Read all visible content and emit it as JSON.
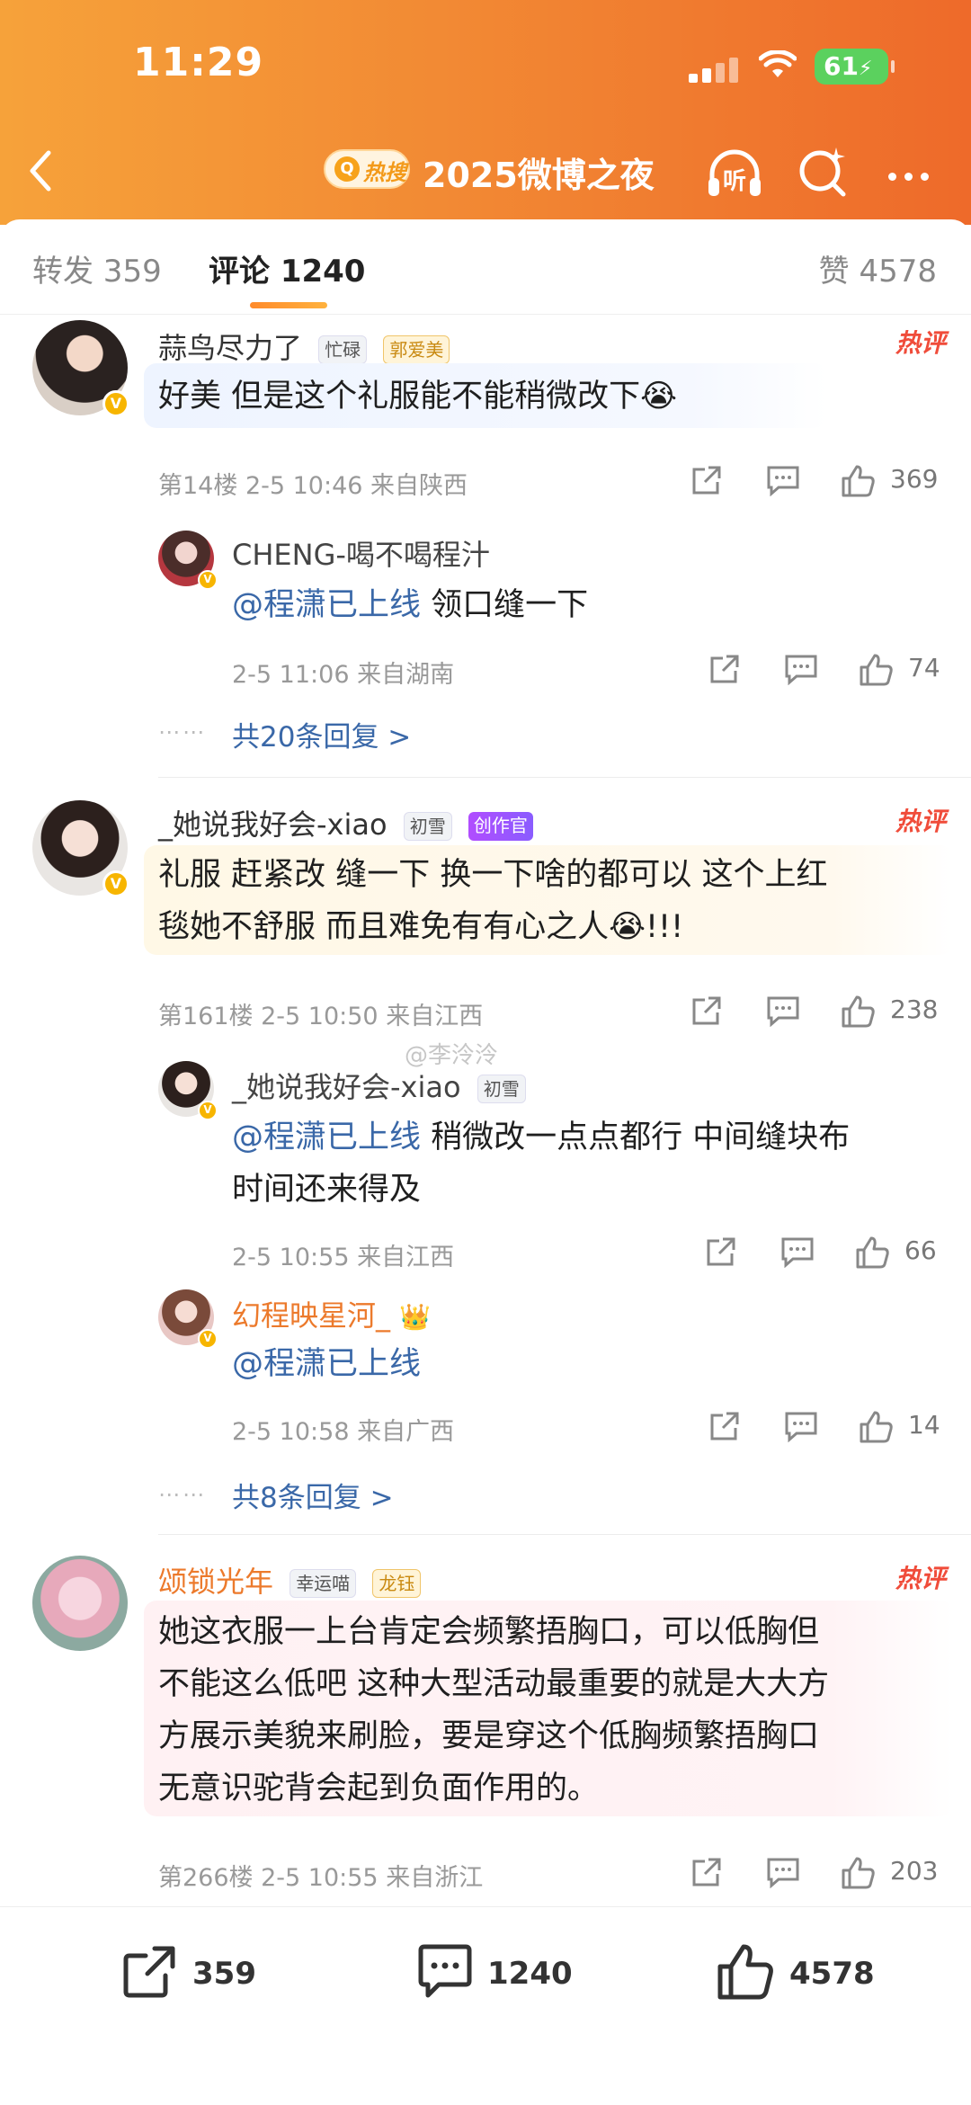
{
  "status": {
    "time": "11:29",
    "battery": "61"
  },
  "nav": {
    "hot_label": "热搜",
    "title": "2025微博之夜",
    "listen_label": "听"
  },
  "tabs": {
    "repost": "转发 359",
    "comment": "评论 1240",
    "like": "赞 4578"
  },
  "comments": [
    {
      "name": "蒜鸟尽力了",
      "medals": [
        "忙碌",
        "郭爱美"
      ],
      "hot": "热评",
      "text": "好美 但是这个礼服能不能稍微改下😭",
      "meta": "第14楼 2-5 10:46 来自陕西",
      "likes": "369",
      "replies": [
        {
          "name": "CHENG-喝不喝程汁",
          "mention": "@程潇已上线",
          "text": "领口缝一下",
          "meta": "2-5 11:06 来自湖南",
          "likes": "74"
        }
      ],
      "more": "共20条回复 >"
    },
    {
      "name": "_她说我好会-xiao",
      "medals": [
        "初雪",
        "创作官"
      ],
      "hot": "热评",
      "text_line1": "礼服 赶紧改 缝一下 换一下啥的都可以 这个上红",
      "text_line2": "毯她不舒服 而且难免有有心之人😭!!!",
      "meta": "第161楼 2-5 10:50 来自江西",
      "likes": "238",
      "replies": [
        {
          "name": "_她说我好会-xiao",
          "medal": "初雪",
          "mention": "@程潇已上线",
          "text_line1": "稍微改一点点都行 中间缝块布",
          "text_line2": "时间还来得及",
          "meta": "2-5 10:55 来自江西",
          "likes": "66"
        },
        {
          "name": "幻程映星河_",
          "mention": "@程潇已上线",
          "meta": "2-5 10:58 来自广西",
          "likes": "14"
        }
      ],
      "more": "共8条回复 >"
    },
    {
      "name": "颂锁光年",
      "medals": [
        "幸运喵",
        "龙钰"
      ],
      "hot": "热评",
      "lines": [
        "她这衣服一上台肯定会频繁捂胸口，可以低胸但",
        "不能这么低吧 这种大型活动最重要的就是大大方",
        "方展示美貌来刷脸，要是穿这个低胸频繁捂胸口",
        "无意识驼背会起到负面作用的。"
      ],
      "meta": "第266楼 2-5 10:55 来自浙江",
      "likes": "203"
    }
  ],
  "watermark": "@李泠泠",
  "bottom": {
    "repost": "359",
    "comment": "1240",
    "like": "4578"
  }
}
